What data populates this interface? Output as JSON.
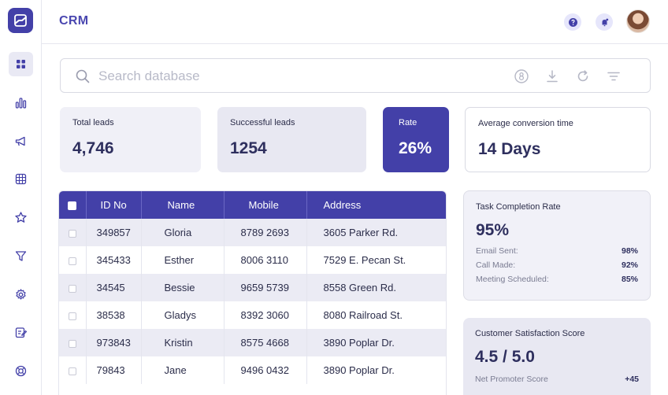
{
  "app": {
    "title": "CRM"
  },
  "sidebar": {
    "items": [
      {
        "name": "dashboard",
        "icon": "grid-icon",
        "active": true
      },
      {
        "name": "analytics",
        "icon": "bar-chart-icon"
      },
      {
        "name": "campaigns",
        "icon": "megaphone-icon"
      },
      {
        "name": "tables",
        "icon": "table-grid-icon"
      },
      {
        "name": "favorites",
        "icon": "star-icon"
      },
      {
        "name": "filters",
        "icon": "filter-icon"
      },
      {
        "name": "settings",
        "icon": "gear-icon"
      },
      {
        "name": "notes",
        "icon": "edit-note-icon"
      },
      {
        "name": "support",
        "icon": "lifebuoy-icon"
      }
    ]
  },
  "header": {
    "help_icon": "question-icon",
    "notification_icon": "bell-icon",
    "avatar": "user-avatar"
  },
  "search": {
    "placeholder": "Search database",
    "value": "",
    "tools": [
      "eight-ball-icon",
      "download-icon",
      "refresh-icon",
      "sort-filter-icon"
    ]
  },
  "stats": [
    {
      "label": "Total leads",
      "value": "4,746"
    },
    {
      "label": "Successful leads",
      "value": "1254"
    },
    {
      "label": "Rate",
      "value": "26%"
    },
    {
      "label": "Average conversion time",
      "value": "14 Days"
    }
  ],
  "table": {
    "columns": [
      "ID No",
      "Name",
      "Mobile",
      "Address"
    ],
    "rows": [
      {
        "id": "349857",
        "name": "Gloria",
        "mobile": "8789 2693",
        "address": "3605 Parker Rd."
      },
      {
        "id": "345433",
        "name": "Esther",
        "mobile": "8006 3110",
        "address": "7529 E. Pecan St."
      },
      {
        "id": "34545",
        "name": "Bessie",
        "mobile": "9659 5739",
        "address": "8558 Green Rd."
      },
      {
        "id": "38538",
        "name": "Gladys",
        "mobile": "8392 3060",
        "address": "8080 Railroad St."
      },
      {
        "id": "973843",
        "name": "Kristin",
        "mobile": "8575 4668",
        "address": "3890 Poplar Dr."
      },
      {
        "id": "79843",
        "name": "Jane",
        "mobile": "9496 0432",
        "address": "3890 Poplar Dr."
      }
    ]
  },
  "task_panel": {
    "title": "Task Completion Rate",
    "value": "95%",
    "rows": [
      {
        "label": "Email Sent:",
        "value": "98%"
      },
      {
        "label": "Call Made:",
        "value": "92%"
      },
      {
        "label": "Meeting Scheduled:",
        "value": "85%"
      }
    ]
  },
  "satisfaction_panel": {
    "title": "Customer Satisfaction Score",
    "value": "4.5 / 5.0",
    "rows": [
      {
        "label": "Net Promoter Score",
        "value": "+45"
      }
    ]
  },
  "colors": {
    "accent": "#4340a8",
    "card_light": "#f0f0f7",
    "row_stripe": "#ebebf4"
  }
}
